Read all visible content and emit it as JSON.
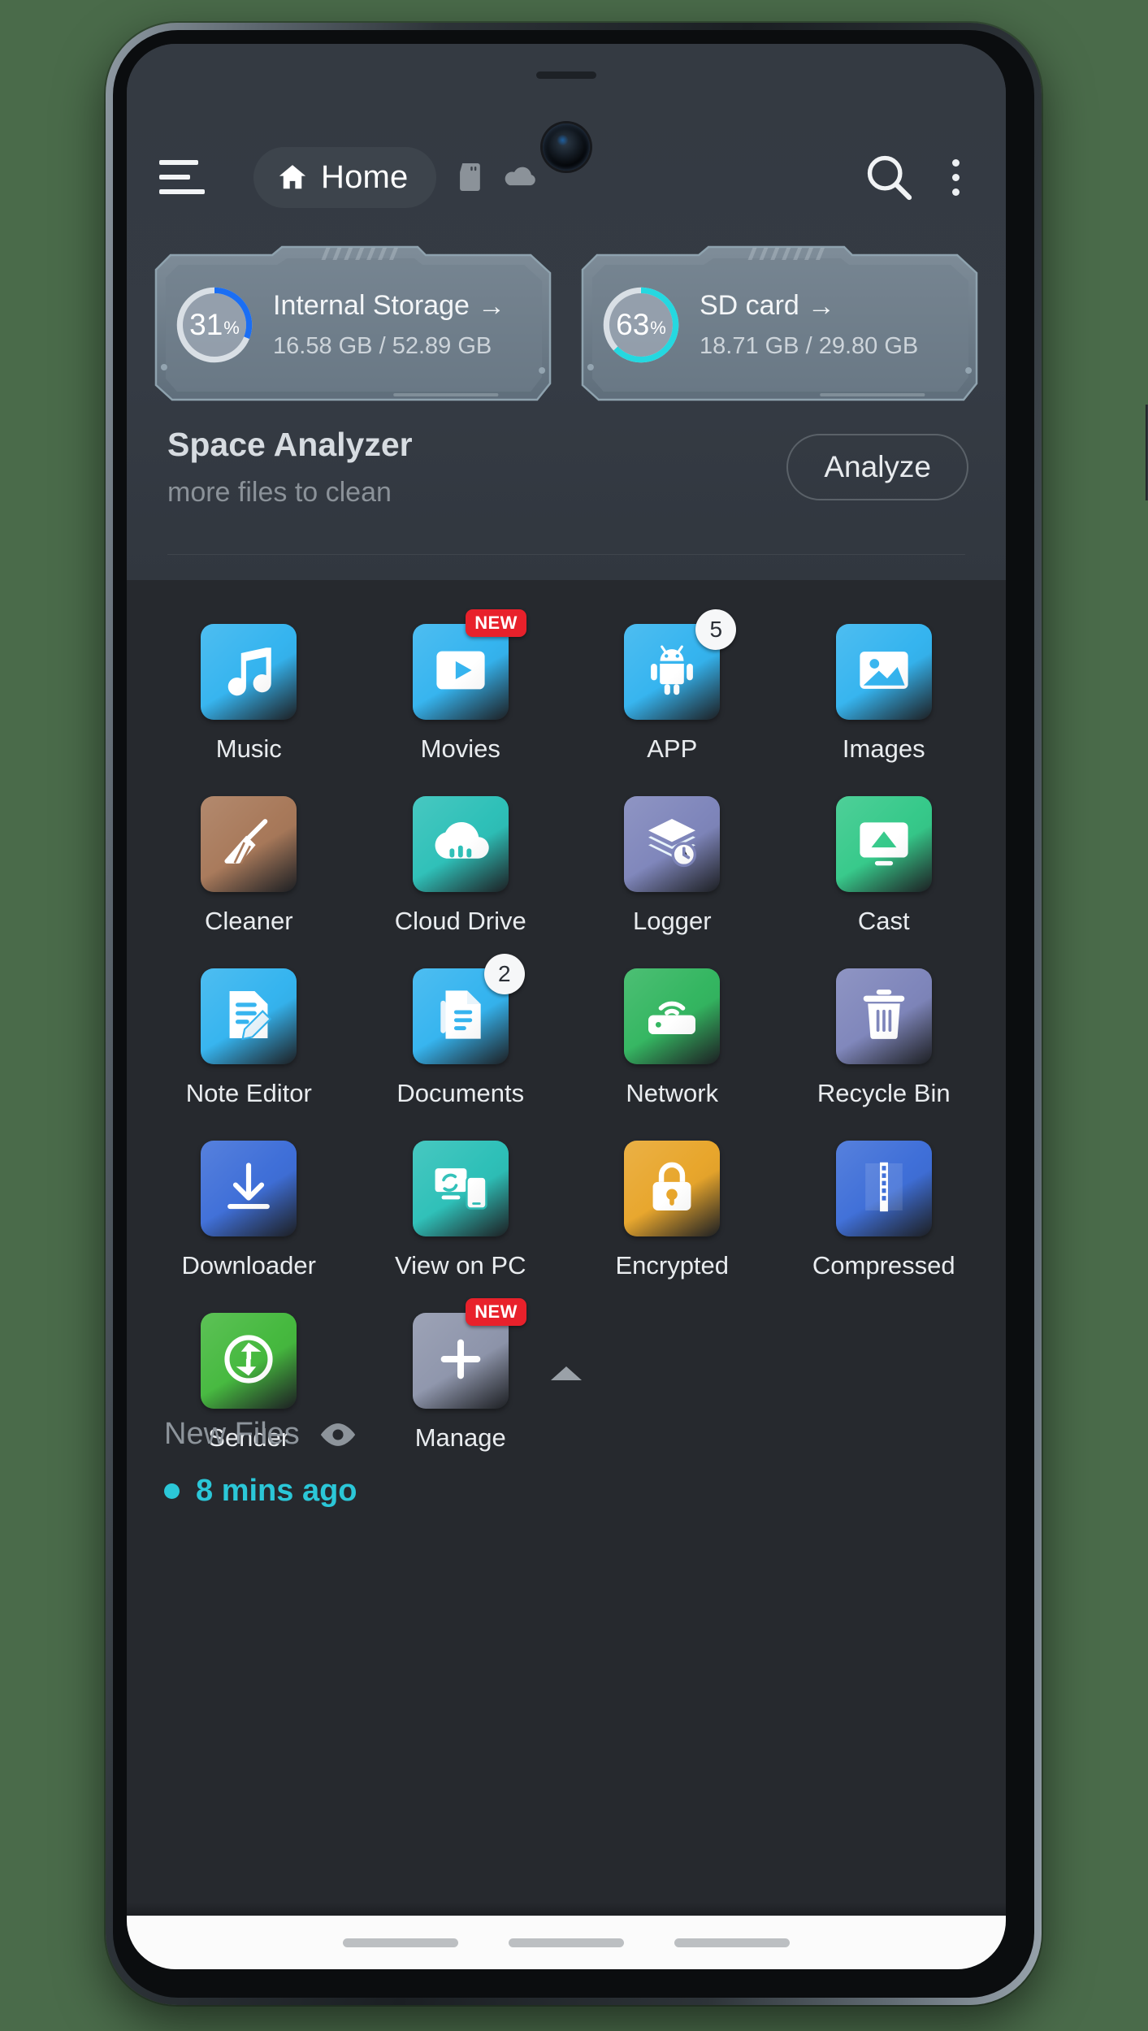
{
  "app": {
    "header": {
      "menu_label": "menu",
      "home_label": "Home",
      "sd_icon": "sd-card-icon",
      "cloud_icon": "cloud-icon",
      "search_icon": "search-icon",
      "overflow_icon": "more-vertical-icon"
    },
    "storage": [
      {
        "name": "Internal Storage",
        "arrow": "→",
        "percent": 31,
        "percent_text": "31",
        "percent_unit": "%",
        "usage": "16.58 GB / 52.89 GB",
        "used": "16.58 GB",
        "total": "52.89 GB",
        "ring_color": "#1b6ef3"
      },
      {
        "name": "SD card",
        "arrow": "→",
        "percent": 63,
        "percent_text": "63",
        "percent_unit": "%",
        "usage": "18.71 GB / 29.80 GB",
        "used": "18.71 GB",
        "total": "29.80 GB",
        "ring_color": "#25d8e0"
      }
    ],
    "analyzer": {
      "title": "Space Analyzer",
      "subtitle": "more files to clean",
      "button": "Analyze"
    },
    "grid": [
      {
        "label": "Music",
        "icon": "music-note-icon",
        "color": "#35b4ef",
        "badge": null,
        "badge_type": null
      },
      {
        "label": "Movies",
        "icon": "video-play-icon",
        "color": "#35b4ef",
        "badge": "NEW",
        "badge_type": "new"
      },
      {
        "label": "APP",
        "icon": "android-robot-icon",
        "color": "#35b4ef",
        "badge": "5",
        "badge_type": "count"
      },
      {
        "label": "Images",
        "icon": "photo-icon",
        "color": "#35b4ef",
        "badge": null,
        "badge_type": null
      },
      {
        "label": "Cleaner",
        "icon": "broom-icon",
        "color": "#a8795a",
        "badge": null,
        "badge_type": null
      },
      {
        "label": "Cloud Drive",
        "icon": "cloud-upload-icon",
        "color": "#2ec0b8",
        "badge": null,
        "badge_type": null
      },
      {
        "label": "Logger",
        "icon": "layers-clock-icon",
        "color": "#7f86bb",
        "badge": null,
        "badge_type": null
      },
      {
        "label": "Cast",
        "icon": "cast-screen-icon",
        "color": "#36c98a",
        "badge": null,
        "badge_type": null
      },
      {
        "label": "Note Editor",
        "icon": "note-pencil-icon",
        "color": "#35b4ef",
        "badge": null,
        "badge_type": null
      },
      {
        "label": "Documents",
        "icon": "document-icon",
        "color": "#35b4ef",
        "badge": "2",
        "badge_type": "count"
      },
      {
        "label": "Network",
        "icon": "wifi-router-icon",
        "color": "#34b661",
        "badge": null,
        "badge_type": null
      },
      {
        "label": "Recycle Bin",
        "icon": "trash-can-icon",
        "color": "#7f86bb",
        "badge": null,
        "badge_type": null
      },
      {
        "label": "Downloader",
        "icon": "download-arrow-icon",
        "color": "#3f6fd8",
        "badge": null,
        "badge_type": null
      },
      {
        "label": "View on PC",
        "icon": "pc-phone-sync-icon",
        "color": "#2ec0b8",
        "badge": null,
        "badge_type": null
      },
      {
        "label": "Encrypted",
        "icon": "padlock-icon",
        "color": "#e8a62c",
        "badge": null,
        "badge_type": null
      },
      {
        "label": "Compressed",
        "icon": "zip-file-icon",
        "color": "#3f6fd8",
        "badge": null,
        "badge_type": null
      },
      {
        "label": "Sender",
        "icon": "sync-arrows-icon",
        "color": "#46b93f",
        "badge": null,
        "badge_type": null
      },
      {
        "label": "Manage",
        "icon": "plus-add-icon",
        "color": "#8f96ac",
        "badge": "NEW",
        "badge_type": "new"
      }
    ],
    "footer": {
      "collapse_icon": "chevron-up-icon",
      "new_files_label": "New Files",
      "eye_icon": "eye-icon",
      "time_label": "8 mins ago"
    },
    "colors": {
      "accent_cyan": "#2bc7d8",
      "accent_blue": "#1b6ef3",
      "badge_red": "#e8212b",
      "top_bg": "#353b44",
      "bottom_bg": "#26292e"
    }
  }
}
